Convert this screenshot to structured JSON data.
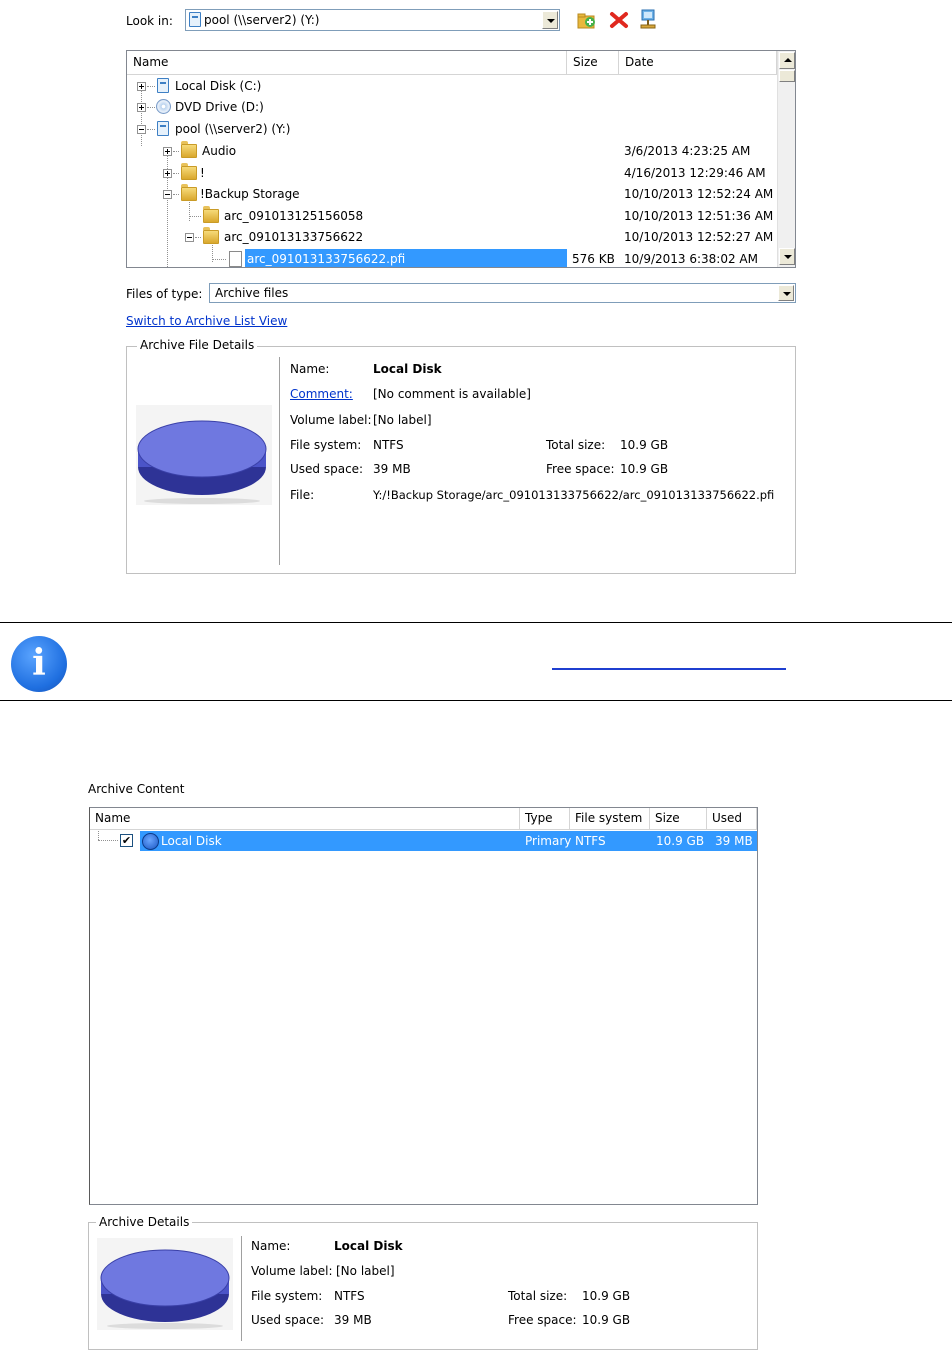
{
  "dialog": {
    "look_in_label": "Look in:",
    "look_in_value": "pool (\\\\server2) (Y:)",
    "toolbar_icons": [
      "new-folder-icon",
      "delete-icon",
      "network-icon"
    ],
    "columns": [
      "Name",
      "Size",
      "Date"
    ],
    "tree": [
      {
        "name": "Local Disk (C:)",
        "size": "",
        "date": "",
        "icon": "hard-disk-icon",
        "expander": "+"
      },
      {
        "name": "DVD Drive (D:)",
        "size": "",
        "date": "",
        "icon": "cd-drive-icon",
        "expander": "+"
      },
      {
        "name": "pool (\\\\server2) (Y:)",
        "size": "",
        "date": "",
        "icon": "network-drive-icon",
        "expander": "-"
      },
      {
        "name": "Audio",
        "size": "",
        "date": "3/6/2013 4:23:25 AM",
        "icon": "folder-icon",
        "expander": "+"
      },
      {
        "name": "!",
        "size": "",
        "date": "4/16/2013 12:29:46 AM",
        "icon": "folder-icon",
        "expander": "+"
      },
      {
        "name": "!Backup Storage",
        "size": "",
        "date": "10/10/2013 12:52:24 AM",
        "icon": "folder-icon",
        "expander": "-"
      },
      {
        "name": "arc_091013125156058",
        "size": "",
        "date": "10/10/2013 12:51:36 AM",
        "icon": "folder-icon",
        "expander": ""
      },
      {
        "name": "arc_091013133756622",
        "size": "",
        "date": "10/10/2013 12:52:27 AM",
        "icon": "folder-icon",
        "expander": "-"
      },
      {
        "name": "arc_091013133756622.pfi",
        "size": "576 KB",
        "date": "10/9/2013 6:38:02 AM",
        "icon": "file-icon",
        "expander": "",
        "selected": true
      }
    ],
    "files_of_type_label": "Files of type:",
    "files_of_type_value": "Archive files",
    "switch_link": "Switch to Archive List View",
    "details_legend": "Archive File Details",
    "details": {
      "name_label": "Name:",
      "name_value": "Local Disk",
      "comment_label": "Comment:",
      "comment_value": "[No comment is available]",
      "volume_label": "Volume label:",
      "volume_value": "[No label]",
      "fs_label": "File system:",
      "fs_value": "NTFS",
      "total_label": "Total size:",
      "total_value": "10.9 GB",
      "used_label": "Used space:",
      "used_value": "39 MB",
      "free_label": "Free space:",
      "free_value": "10.9 GB",
      "file_label": "File:",
      "file_value": "Y:/!Backup Storage/arc_091013133756622/arc_091013133756622.pfi"
    }
  },
  "archive_content": {
    "title": "Archive Content",
    "columns": [
      "Name",
      "Type",
      "File system",
      "Size",
      "Used"
    ],
    "rows": [
      {
        "name": "Local Disk",
        "type": "Primary",
        "fs": "NTFS",
        "size": "10.9 GB",
        "used": "39 MB",
        "checked": true
      }
    ],
    "details_legend": "Archive Details",
    "details": {
      "name_label": "Name:",
      "name_value": "Local Disk",
      "volume_label": "Volume label:",
      "volume_value": "[No label]",
      "fs_label": "File system:",
      "fs_value": "NTFS",
      "total_label": "Total size:",
      "total_value": "10.9 GB",
      "used_label": "Used space:",
      "used_value": "39 MB",
      "free_label": "Free space:",
      "free_value": "10.9 GB"
    }
  },
  "colors": {
    "selection": "#3399ff",
    "link": "#0033cc",
    "disk": "#6f78e0",
    "info": "#1f6fe0"
  }
}
